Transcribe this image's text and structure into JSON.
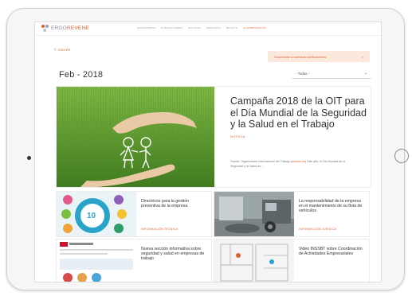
{
  "site": {
    "logo_prefix": "ERGO",
    "logo_suffix": "REVENE"
  },
  "nav": {
    "items": [
      {
        "label": "ENCUENTROS"
      },
      {
        "label": "PUBLICACIONES"
      },
      {
        "label": "NOTICIAS"
      },
      {
        "label": "SERVICIOS"
      },
      {
        "label": "BOLETÍN"
      }
    ],
    "active_label": "ALUPREVENCIÓN"
  },
  "back": {
    "label": "VOLVER"
  },
  "subscribe": {
    "label": "Suscríbase a nuestras publicaciones",
    "close": "×"
  },
  "page": {
    "title": "Feb - 2018"
  },
  "filter": {
    "selected": "- Todas -"
  },
  "hero": {
    "title": "Campaña 2018 de la OIT para el Día Mundial de la Seguridad y la Salud en el Trabajo",
    "tag": "NOTICIA",
    "source_prefix": "Fuente: Organización Internacional del Trabajo (",
    "source_link": "www.ilo.es",
    "source_suffix": ") Este año, el Día Mundial de la Seguridad y la Salud en..."
  },
  "cards": [
    {
      "title": "Directrices para la gestión preventiva de la empresa",
      "tag": "INFORMACIÓN TÉCNICA"
    },
    {
      "title": "La responsabilidad de la empresa en el mantenimiento de su flota de vehículos",
      "tag": "INFORMACIÓN JURÍDICA"
    },
    {
      "title": "Nueva sección informativa sobre seguridad y salud en empresas de trabajo",
      "tag": ""
    },
    {
      "title": "Video INSSBT sobre Coordinación de Actividades Empresariales",
      "tag": ""
    }
  ],
  "images": {
    "card1_badge": "10"
  },
  "colors": {
    "accent": "#e2612d",
    "subscribe_bg": "#fde8de",
    "grass": "#5f9b2d"
  }
}
